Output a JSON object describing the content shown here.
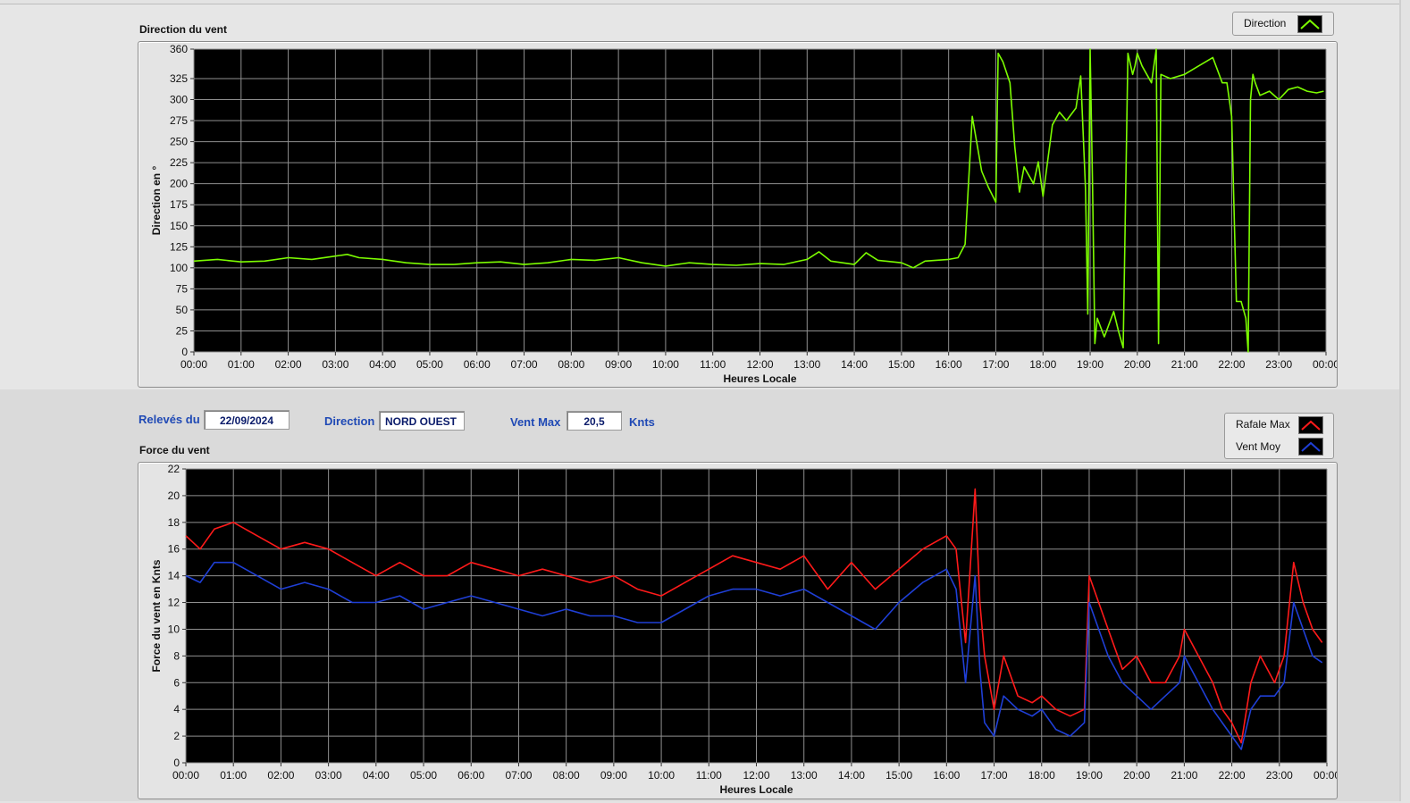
{
  "controls": {
    "releves_label": "Relevés du",
    "date_value": "22/09/2024",
    "direction_label": "Direction",
    "direction_value": "NORD OUEST",
    "ventmax_label": "Vent Max",
    "ventmax_value": "20,5",
    "ventmax_unit": "Knts"
  },
  "legend_top": {
    "items": [
      {
        "label": "Direction",
        "color": "#7CFC00"
      }
    ]
  },
  "legend_bottom": {
    "items": [
      {
        "label": "Rafale Max",
        "color": "#ff1a1a"
      },
      {
        "label": "Vent Moy",
        "color": "#1f3fd6"
      }
    ]
  },
  "chart_data": [
    {
      "type": "line",
      "title": "Direction du vent",
      "xlabel": "Heures Locale",
      "ylabel": "Direction en °",
      "xlim": [
        0,
        24
      ],
      "ylim": [
        0,
        360
      ],
      "x_tick_labels": [
        "00:00",
        "01:00",
        "02:00",
        "03:00",
        "04:00",
        "05:00",
        "06:00",
        "07:00",
        "08:00",
        "09:00",
        "10:00",
        "11:00",
        "12:00",
        "13:00",
        "14:00",
        "15:00",
        "16:00",
        "17:00",
        "18:00",
        "19:00",
        "20:00",
        "21:00",
        "22:00",
        "23:00",
        "00:00"
      ],
      "y_ticks": [
        0,
        25,
        50,
        75,
        100,
        125,
        150,
        175,
        200,
        225,
        250,
        275,
        300,
        325,
        360
      ],
      "grid": true,
      "series": [
        {
          "name": "Direction",
          "color": "#7CFC00",
          "x": [
            0,
            0.5,
            1,
            1.5,
            2,
            2.5,
            3,
            3.25,
            3.5,
            4,
            4.5,
            5,
            5.5,
            6,
            6.5,
            7,
            7.5,
            8,
            8.5,
            9,
            9.5,
            10,
            10.5,
            11,
            11.5,
            12,
            12.5,
            13,
            13.25,
            13.5,
            14,
            14.25,
            14.5,
            15,
            15.25,
            15.5,
            16,
            16.2,
            16.35,
            16.5,
            16.7,
            16.85,
            17,
            17.05,
            17.15,
            17.3,
            17.4,
            17.5,
            17.6,
            17.8,
            17.9,
            18,
            18.2,
            18.35,
            18.5,
            18.7,
            18.8,
            18.9,
            18.95,
            19.0,
            19.05,
            19.1,
            19.15,
            19.3,
            19.5,
            19.6,
            19.7,
            19.8,
            19.9,
            19.95,
            20.0,
            20.1,
            20.3,
            20.4,
            20.45,
            20.5,
            20.7,
            21,
            21.3,
            21.6,
            21.8,
            21.9,
            22.0,
            22.1,
            22.2,
            22.3,
            22.35,
            22.4,
            22.45,
            22.5,
            22.6,
            22.8,
            23,
            23.2,
            23.4,
            23.6,
            23.8,
            23.95
          ],
          "y": [
            108,
            110,
            107,
            108,
            112,
            110,
            114,
            116,
            112,
            110,
            106,
            104,
            104,
            106,
            107,
            104,
            106,
            110,
            109,
            112,
            106,
            102,
            106,
            104,
            103,
            105,
            104,
            110,
            119,
            108,
            104,
            118,
            109,
            106,
            100,
            108,
            110,
            112,
            128,
            280,
            215,
            195,
            178,
            355,
            345,
            320,
            245,
            190,
            220,
            200,
            226,
            185,
            270,
            285,
            275,
            290,
            328,
            195,
            45,
            360,
            200,
            10,
            40,
            18,
            48,
            25,
            5,
            355,
            330,
            340,
            355,
            340,
            320,
            360,
            10,
            330,
            325,
            330,
            340,
            350,
            320,
            320,
            280,
            60,
            60,
            40,
            0,
            300,
            330,
            320,
            305,
            310,
            300,
            312,
            315,
            310,
            308,
            310
          ]
        }
      ]
    },
    {
      "type": "line",
      "title": "Force du vent",
      "xlabel": "Heures Locale",
      "ylabel": "Force du vent en Knts",
      "xlim": [
        0,
        24
      ],
      "ylim": [
        0,
        22
      ],
      "x_tick_labels": [
        "00:00",
        "01:00",
        "02:00",
        "03:00",
        "04:00",
        "05:00",
        "06:00",
        "07:00",
        "08:00",
        "09:00",
        "10:00",
        "11:00",
        "12:00",
        "13:00",
        "14:00",
        "15:00",
        "16:00",
        "17:00",
        "18:00",
        "19:00",
        "20:00",
        "21:00",
        "22:00",
        "23:00",
        "00:00"
      ],
      "y_ticks": [
        0,
        2,
        4,
        6,
        8,
        10,
        12,
        14,
        16,
        18,
        20,
        22
      ],
      "grid": true,
      "series": [
        {
          "name": "Rafale Max",
          "color": "#ff1a1a",
          "x": [
            0,
            0.3,
            0.6,
            1,
            1.5,
            2,
            2.5,
            3,
            3.5,
            4,
            4.5,
            5,
            5.5,
            6,
            6.5,
            7,
            7.5,
            8,
            8.5,
            9,
            9.5,
            10,
            10.5,
            11,
            11.5,
            12,
            12.5,
            13,
            13.5,
            14,
            14.5,
            15,
            15.5,
            16,
            16.2,
            16.4,
            16.6,
            16.7,
            16.8,
            17,
            17.2,
            17.5,
            17.8,
            18,
            18.3,
            18.6,
            18.9,
            19,
            19.1,
            19.4,
            19.7,
            20,
            20.3,
            20.6,
            20.9,
            21,
            21.3,
            21.6,
            21.8,
            22,
            22.2,
            22.4,
            22.6,
            22.9,
            23.1,
            23.3,
            23.5,
            23.7,
            23.9
          ],
          "y": [
            17,
            16,
            17.5,
            18,
            17,
            16,
            16.5,
            16,
            15,
            14,
            15,
            14,
            14,
            15,
            14.5,
            14,
            14.5,
            14,
            13.5,
            14,
            13,
            12.5,
            13.5,
            14.5,
            15.5,
            15,
            14.5,
            15.5,
            13,
            15,
            13,
            14.5,
            16,
            17,
            16,
            9,
            20.5,
            12,
            8,
            4,
            8,
            5,
            4.5,
            5,
            4,
            3.5,
            4,
            14,
            13,
            10,
            7,
            8,
            6,
            6,
            8,
            10,
            8,
            6,
            4,
            3,
            1.5,
            6,
            8,
            6,
            8,
            15,
            12,
            10,
            9
          ]
        },
        {
          "name": "Vent Moy",
          "color": "#1f3fd6",
          "x": [
            0,
            0.3,
            0.6,
            1,
            1.5,
            2,
            2.5,
            3,
            3.5,
            4,
            4.5,
            5,
            5.5,
            6,
            6.5,
            7,
            7.5,
            8,
            8.5,
            9,
            9.5,
            10,
            10.5,
            11,
            11.5,
            12,
            12.5,
            13,
            13.5,
            14,
            14.5,
            15,
            15.5,
            16,
            16.2,
            16.4,
            16.6,
            16.7,
            16.8,
            17,
            17.2,
            17.5,
            17.8,
            18,
            18.3,
            18.6,
            18.9,
            19,
            19.1,
            19.4,
            19.7,
            20,
            20.3,
            20.6,
            20.9,
            21,
            21.3,
            21.6,
            21.8,
            22,
            22.2,
            22.4,
            22.6,
            22.9,
            23.1,
            23.3,
            23.5,
            23.7,
            23.9
          ],
          "y": [
            14,
            13.5,
            15,
            15,
            14,
            13,
            13.5,
            13,
            12,
            12,
            12.5,
            11.5,
            12,
            12.5,
            12,
            11.5,
            11,
            11.5,
            11,
            11,
            10.5,
            10.5,
            11.5,
            12.5,
            13,
            13,
            12.5,
            13,
            12,
            11,
            10,
            12,
            13.5,
            14.5,
            13,
            6,
            14,
            7,
            3,
            2,
            5,
            4,
            3.5,
            4,
            2.5,
            2,
            3,
            12,
            11,
            8,
            6,
            5,
            4,
            5,
            6,
            8,
            6,
            4,
            3,
            2,
            1,
            4,
            5,
            5,
            6,
            12,
            10,
            8,
            7.5
          ]
        }
      ]
    }
  ]
}
